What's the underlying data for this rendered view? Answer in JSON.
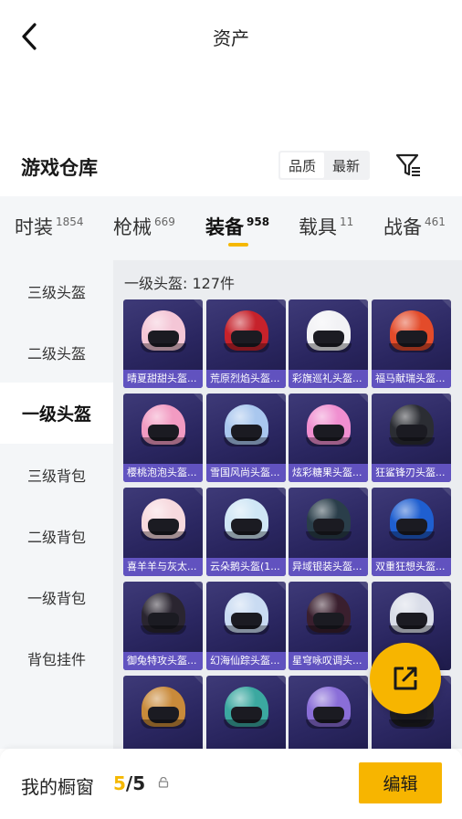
{
  "header": {
    "title": "资产",
    "back_icon": "chevron-left-icon"
  },
  "warehouse": {
    "title": "游戏仓库",
    "sort_options": [
      "品质",
      "最新"
    ],
    "sort_selected": "品质",
    "filter_icon": "filter-icon"
  },
  "categories": [
    {
      "label": "时装",
      "count": "1854",
      "active": false
    },
    {
      "label": "枪械",
      "count": "669",
      "active": false
    },
    {
      "label": "装备",
      "count": "958",
      "active": true
    },
    {
      "label": "载具",
      "count": "11",
      "active": false
    },
    {
      "label": "战备",
      "count": "461",
      "active": false
    }
  ],
  "side_menu": [
    {
      "label": "三级头盔",
      "active": false
    },
    {
      "label": "二级头盔",
      "active": false
    },
    {
      "label": "一级头盔",
      "active": true
    },
    {
      "label": "三级背包",
      "active": false
    },
    {
      "label": "二级背包",
      "active": false
    },
    {
      "label": "一级背包",
      "active": false
    },
    {
      "label": "背包挂件",
      "active": false
    }
  ],
  "grid": {
    "title": "一级头盔: 127件",
    "items": [
      {
        "name": "晴夏甜甜头盔...",
        "color": "#f4c6d6"
      },
      {
        "name": "荒原烈焰头盔...",
        "color": "#c6222b"
      },
      {
        "name": "彩旗巡礼头盔...",
        "color": "#f2f2f5"
      },
      {
        "name": "福马献瑞头盔...",
        "color": "#e34b2a"
      },
      {
        "name": "樱桃泡泡头盔...",
        "color": "#f29bc2"
      },
      {
        "name": "雪国风尚头盔...",
        "color": "#a9c7ee"
      },
      {
        "name": "炫彩糖果头盔...",
        "color": "#f08fd0"
      },
      {
        "name": "狂鲨锋刃头盔...",
        "color": "#2b2d33"
      },
      {
        "name": "喜羊羊与灰太...",
        "color": "#f7d9de"
      },
      {
        "name": "云朵鹅头盔(1...",
        "color": "#cfe6f5"
      },
      {
        "name": "异域银装头盔...",
        "color": "#2a3e4a"
      },
      {
        "name": "双重狂想头盔...",
        "color": "#1f5fd0"
      },
      {
        "name": "御兔特攻头盔...",
        "color": "#2a2530"
      },
      {
        "name": "幻海仙踪头盔...",
        "color": "#c9dbf2"
      },
      {
        "name": "星穹咏叹调头...",
        "color": "#3a1f2e"
      },
      {
        "name": "",
        "color": "#d9dde8"
      },
      {
        "name": "",
        "color": "#c98a3a"
      },
      {
        "name": "",
        "color": "#3ba8a0"
      },
      {
        "name": "",
        "color": "#8a6ed8"
      },
      {
        "name": "",
        "color": "#1e1e22"
      }
    ]
  },
  "fab": {
    "icon": "share-external-icon"
  },
  "showcase": {
    "label": "我的橱窗",
    "current": "5",
    "separator": "/",
    "max": "5",
    "lock_icon": "lock-icon",
    "edit_label": "编辑"
  },
  "colors": {
    "accent": "#f7b500",
    "tile_bg": "#2a2660",
    "tile_label": "#6c5cd2"
  }
}
